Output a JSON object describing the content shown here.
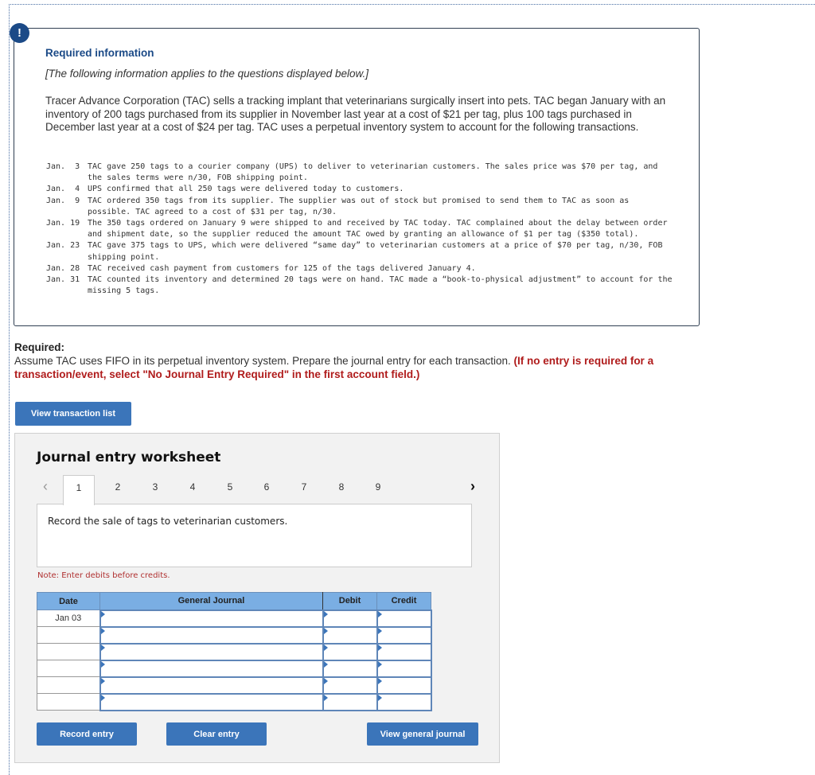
{
  "info": {
    "alert_icon": "!",
    "title": "Required information",
    "subtitle": "[The following information applies to the questions displayed below.]",
    "intro": "Tracer Advance Corporation (TAC) sells a tracking implant that veterinarians surgically insert into pets. TAC began January with an inventory of 200 tags purchased from its supplier in November last year at a cost of $21 per tag, plus 100 tags purchased in December last year at a cost of $24 per tag. TAC uses a perpetual inventory system to account for the following transactions.",
    "transactions": [
      {
        "date": "Jan.  3",
        "text": "TAC gave 250 tags to a courier company (UPS) to deliver to veterinarian customers. The sales price was $70 per tag, and the sales terms were n/30, FOB shipping point."
      },
      {
        "date": "Jan.  4",
        "text": "UPS confirmed that all 250 tags were delivered today to customers."
      },
      {
        "date": "Jan.  9",
        "text": "TAC ordered 350 tags from its supplier. The supplier was out of stock but promised to send them to TAC as soon as possible. TAC agreed to a cost of $31 per tag, n/30."
      },
      {
        "date": "Jan. 19",
        "text": "The 350 tags ordered on January 9 were shipped to and received by TAC today. TAC complained about the delay between order and shipment date, so the supplier reduced the amount TAC owed by granting an allowance of $1 per tag ($350 total)."
      },
      {
        "date": "Jan. 23",
        "text": "TAC gave 375 tags to UPS, which were delivered “same day” to veterinarian customers at a price of $70 per tag, n/30, FOB shipping point."
      },
      {
        "date": "Jan. 28",
        "text": "TAC received cash payment from customers for 125 of the tags delivered January 4."
      },
      {
        "date": "Jan. 31",
        "text": "TAC counted its inventory and determined 20 tags were on hand. TAC made a “book-to-physical adjustment” to account for the missing 5 tags."
      }
    ]
  },
  "required": {
    "label": "Required:",
    "text": "Assume TAC uses FIFO in its perpetual inventory system. Prepare the journal entry for each transaction.",
    "highlight": "(If no entry is required for a transaction/event, select \"No Journal Entry Required\" in the first account field.)"
  },
  "buttons": {
    "view_transaction_list": "View transaction list",
    "record_entry": "Record entry",
    "clear_entry": "Clear entry",
    "view_general_journal": "View general journal"
  },
  "worksheet": {
    "title": "Journal entry worksheet",
    "prev_icon": "‹",
    "next_icon": "›",
    "tabs": [
      "1",
      "2",
      "3",
      "4",
      "5",
      "6",
      "7",
      "8",
      "9"
    ],
    "active_tab": "1",
    "prompt": "Record the sale of tags to veterinarian customers.",
    "note": "Note: Enter debits before credits.",
    "columns": {
      "date": "Date",
      "general_journal": "General Journal",
      "debit": "Debit",
      "credit": "Credit"
    },
    "rows": [
      {
        "date": "Jan 03",
        "account": "",
        "debit": "",
        "credit": ""
      },
      {
        "date": "",
        "account": "",
        "debit": "",
        "credit": ""
      },
      {
        "date": "",
        "account": "",
        "debit": "",
        "credit": ""
      },
      {
        "date": "",
        "account": "",
        "debit": "",
        "credit": ""
      },
      {
        "date": "",
        "account": "",
        "debit": "",
        "credit": ""
      },
      {
        "date": "",
        "account": "",
        "debit": "",
        "credit": ""
      }
    ]
  }
}
